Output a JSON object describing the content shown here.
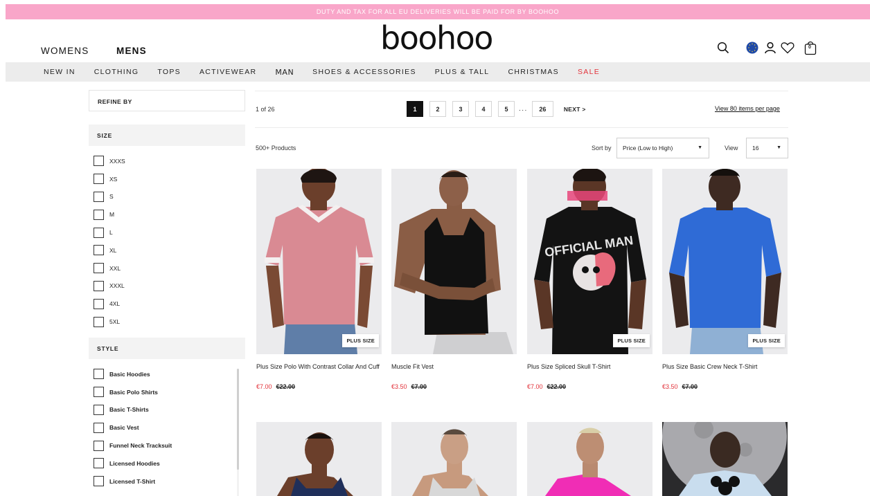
{
  "promo": "DUTY AND TAX FOR ALL EU DELIVERIES WILL BE PAID FOR BY BOOHOO",
  "brand": "boohoo",
  "gender_tabs": [
    "WOMENS",
    "MENS"
  ],
  "header_icons": [
    "search-icon",
    "eu-flag-icon",
    "account-icon",
    "wishlist-heart-icon",
    "bag-icon"
  ],
  "bag_count": "0",
  "nav": [
    "NEW IN",
    "CLOTHING",
    "TOPS",
    "ACTIVEWEAR",
    "MAN",
    "SHOES & ACCESSORIES",
    "PLUS & TALL",
    "CHRISTMAS",
    "SALE"
  ],
  "colors": {
    "promo": "#f9a6c9",
    "sale": "#e2323a",
    "nav_bg": "#ececec"
  },
  "refine_label": "REFINE BY",
  "size_facet": {
    "title": "SIZE",
    "options": [
      "XXXS",
      "XS",
      "S",
      "M",
      "L",
      "XL",
      "XXL",
      "XXXL",
      "4XL",
      "5XL"
    ]
  },
  "style_facet": {
    "title": "STYLE",
    "options": [
      "Basic Hoodies",
      "Basic Polo Shirts",
      "Basic T-Shirts",
      "Basic Vest",
      "Funnel Neck Tracksuit",
      "Licensed Hoodies",
      "Licensed T-Shirt"
    ]
  },
  "pagination": {
    "status": "1 of 26",
    "pages": [
      "1",
      "2",
      "3",
      "4",
      "5"
    ],
    "ellipsis": "...",
    "last": "26",
    "next": "NEXT >",
    "current": "1"
  },
  "per_page_link": "View 80 items per page",
  "total": "500+ Products",
  "sort": {
    "label": "Sort by",
    "value": "Price (Low to High)"
  },
  "view": {
    "label": "View",
    "value": "16"
  },
  "products": [
    {
      "name": "Plus Size Polo With Contrast Collar And Cuff",
      "price": "€7.00",
      "was": "€22.00",
      "badge": "PLUS SIZE"
    },
    {
      "name": "Muscle Fit Vest",
      "price": "€3.50",
      "was": "€7.00",
      "badge": ""
    },
    {
      "name": "Plus Size Spliced Skull T-Shirt",
      "price": "€7.00",
      "was": "€22.00",
      "badge": "PLUS SIZE"
    },
    {
      "name": "Plus Size Basic Crew Neck T-Shirt",
      "price": "€3.50",
      "was": "€7.00",
      "badge": "PLUS SIZE"
    }
  ],
  "artwork_text": "OFFICIAL MAN"
}
